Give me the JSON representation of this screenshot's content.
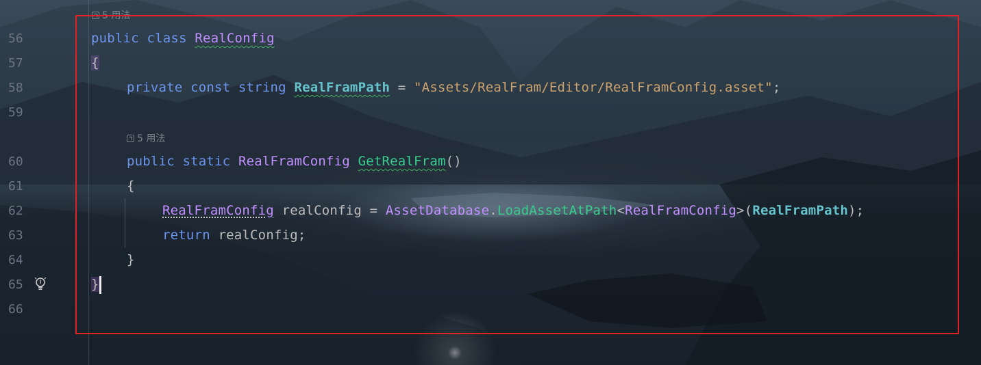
{
  "editor": {
    "line_numbers": [
      "56",
      "57",
      "58",
      "59",
      "60",
      "61",
      "62",
      "63",
      "64",
      "65",
      "66"
    ],
    "usages_label": "5 用法",
    "usages_icon": "external-link-icon",
    "gutter_icon": "lightbulb-icon",
    "lines": {
      "l56": {
        "kw1": "public",
        "kw2": "class",
        "name": "RealConfig"
      },
      "l57": {
        "brace": "{"
      },
      "l58": {
        "kw1": "private",
        "kw2": "const",
        "kw3": "string",
        "field": "RealFramPath",
        "eq": " = ",
        "value": "\"Assets/RealFram/Editor/RealFramConfig.asset\"",
        "semi": ";"
      },
      "l60": {
        "kw1": "public",
        "kw2": "static",
        "type": "RealFramConfig",
        "method": "GetRealFram",
        "parens": "()"
      },
      "l61": {
        "brace": "{"
      },
      "l62": {
        "type": "RealFramConfig",
        "var": " realConfig = ",
        "cls": "AssetDatabase",
        "dot": ".",
        "method": "LoadAssetAtPath",
        "lt": "<",
        "generic": "RealFramConfig",
        "gt_open": ">(",
        "arg": "RealFramPath",
        "close": ");"
      },
      "l63": {
        "kw": "return",
        "rest": " realConfig;"
      },
      "l64": {
        "brace": "}"
      },
      "l65": {
        "brace": "}"
      }
    }
  },
  "colors": {
    "keyword": "#6c95eb",
    "class": "#c191ff",
    "field": "#66c3cc",
    "string": "#c9a26d",
    "method": "#39cc8f",
    "highlight_box": "#e02225"
  }
}
